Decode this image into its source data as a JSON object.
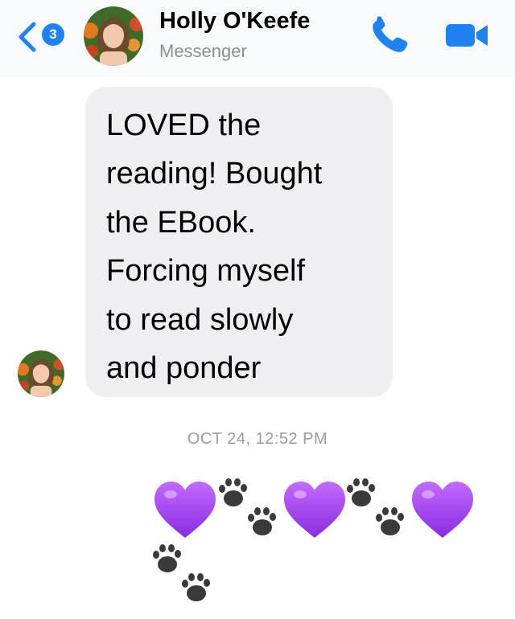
{
  "header": {
    "back_badge_count": "3",
    "contact_name": "Holly O'Keefe",
    "subtitle": "Messenger",
    "icons": [
      "back-chevron-icon",
      "phone-icon",
      "video-camera-icon"
    ],
    "accent_color": "#1e83f0"
  },
  "conversation": {
    "incoming_message": {
      "lines": [
        "LOVED the",
        "reading!  Bought",
        "the EBook.",
        "Forcing myself",
        "to read slowly",
        "and ponder"
      ]
    },
    "timestamp": "OCT 24, 12:52 PM",
    "emoji_message": {
      "sequence": [
        "purple-heart",
        "paw-prints",
        "purple-heart",
        "paw-prints",
        "purple-heart",
        "paw-prints"
      ]
    }
  }
}
